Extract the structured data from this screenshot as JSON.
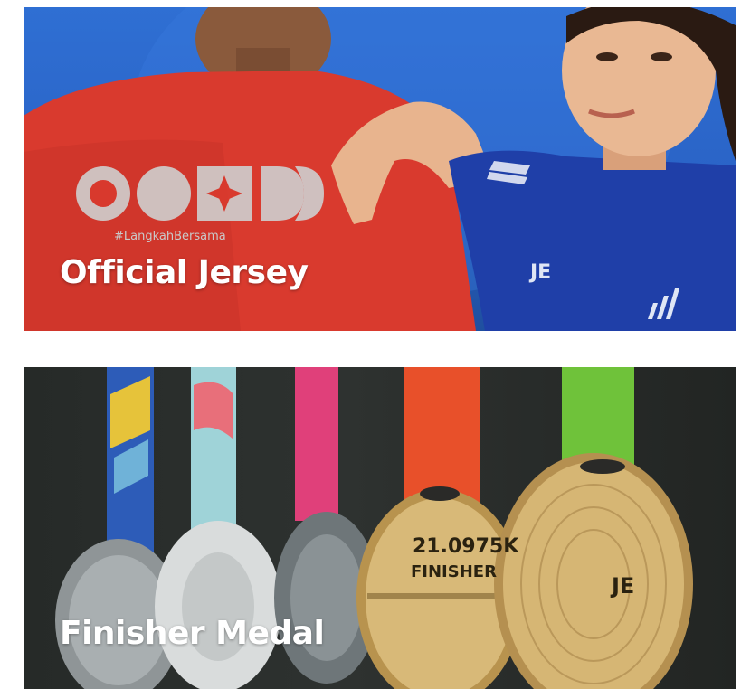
{
  "cards": [
    {
      "title": "Official Jersey",
      "hashtag": "#LangkahBersama",
      "accent_color": "#2f6fd3"
    },
    {
      "title": "Finisher Medal",
      "medal_label_line1": "21.0975K",
      "medal_label_line2": "FINISHER",
      "accent_color": "#c9a85c"
    }
  ]
}
